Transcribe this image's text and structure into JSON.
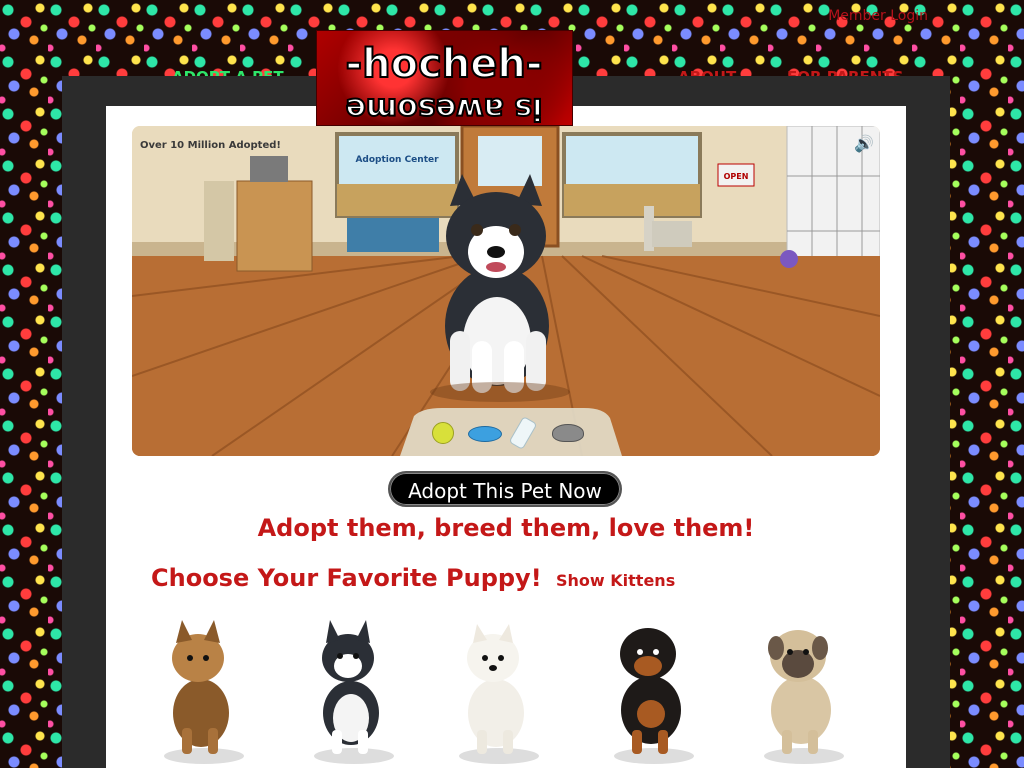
{
  "header": {
    "member_login": "Member Login",
    "nav": {
      "adopt_a_pet": "ADOPT A PET",
      "about": "ABOUT",
      "for_parents": "FOR PARENTS"
    },
    "logo": {
      "line1": "-hocheh-",
      "line2": "is awesome"
    }
  },
  "hero": {
    "badge": "Over 10 Million Adopted!",
    "window_sign": "Adoption Center",
    "door_sign": "OPEN",
    "tray_items": [
      "tennis-ball-icon",
      "frisbee-icon",
      "bottle-icon",
      "food-bowl-icon"
    ],
    "sound_icon": "speaker-icon",
    "adopt_button": "Adopt This Pet Now"
  },
  "tagline": "Adopt them, breed them, love them!",
  "choose": {
    "title": "Choose Your Favorite Puppy!",
    "show_kittens": "Show Kittens"
  },
  "puppies": [
    {
      "breed_icon": "yorkie-puppy-icon"
    },
    {
      "breed_icon": "husky-puppy-icon"
    },
    {
      "breed_icon": "westie-puppy-icon"
    },
    {
      "breed_icon": "rottweiler-puppy-icon"
    },
    {
      "breed_icon": "mastiff-puppy-icon"
    }
  ],
  "colors": {
    "accent_red": "#c41818",
    "nav_green": "#2ee66a",
    "frame": "#2b2b2b"
  }
}
